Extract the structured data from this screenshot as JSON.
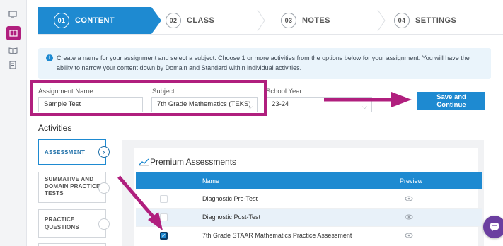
{
  "rail": {
    "icons": [
      "monitor-icon",
      "book-icon",
      "open-book-icon",
      "document-icon"
    ]
  },
  "steps": [
    {
      "num": "01",
      "label": "CONTENT",
      "active": true
    },
    {
      "num": "02",
      "label": "CLASS",
      "active": false
    },
    {
      "num": "03",
      "label": "NOTES",
      "active": false
    },
    {
      "num": "04",
      "label": "SETTINGS",
      "active": false
    }
  ],
  "info": {
    "text": "Create a name for your assignment and select a subject. Choose 1 or more activities from the options below for your assignment. You will have the ability to narrow your content down by Domain and Standard within individual activities."
  },
  "form": {
    "assignment_name_label": "Assignment Name",
    "assignment_name_value": "Sample Test",
    "subject_label": "Subject",
    "subject_value": "7th Grade Mathematics (TEKS)",
    "school_year_label": "School Year",
    "school_year_value": "23-24",
    "save_label": "Save and Continue"
  },
  "activities": {
    "heading": "Activities",
    "items": [
      {
        "label": "ASSESSMENT",
        "active": true
      },
      {
        "label": "SUMMATIVE AND DOMAIN PRACTICE TESTS",
        "active": false
      },
      {
        "label": "PRACTICE QUESTIONS",
        "active": false
      }
    ]
  },
  "premium": {
    "title": "Premium Assessments",
    "columns": [
      "Name",
      "Preview"
    ],
    "rows": [
      {
        "name": "Diagnostic Pre-Test",
        "checked": false
      },
      {
        "name": "Diagnostic Post-Test",
        "checked": false
      },
      {
        "name": "7th Grade STAAR Mathematics Practice Assessment",
        "checked": true
      }
    ]
  },
  "colors": {
    "accent": "#1e8ad1",
    "highlight": "#b01f7e",
    "chat": "#6b3fa0"
  }
}
